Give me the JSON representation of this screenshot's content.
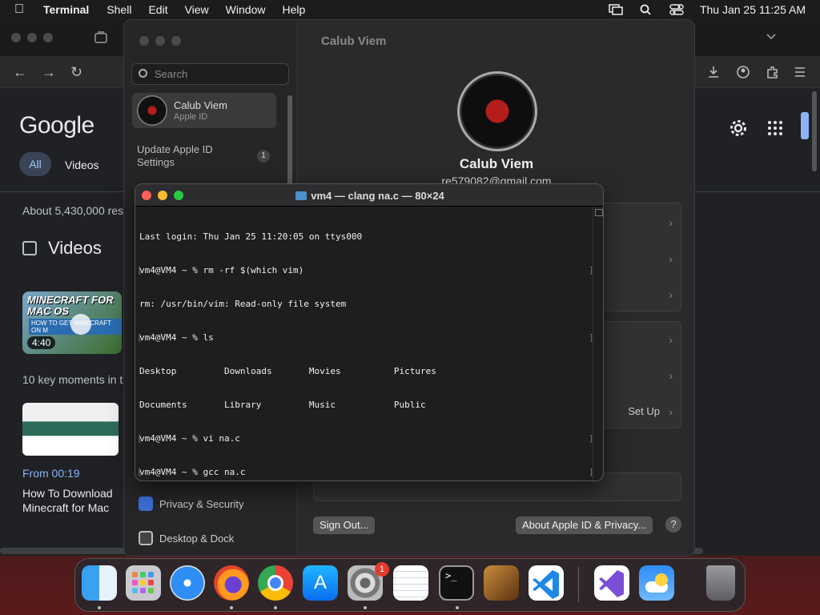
{
  "menubar": {
    "app": "Terminal",
    "items": [
      "Shell",
      "Edit",
      "View",
      "Window",
      "Help"
    ],
    "datetime": "Thu Jan 25  11:25 AM"
  },
  "browser": {
    "logo": "Google",
    "tabs": [
      "All",
      "Videos"
    ],
    "results": "About 5,430,000 res",
    "videos_heading": "Videos",
    "thumb_title": "MINECRAFT FOR MAC OS",
    "thumb_subtitle": "HOW TO GET MINECRAFT ON M",
    "duration": "4:40",
    "key_moments": "10 key moments in t",
    "from": "From 00:19",
    "video_title_1": "How To Download",
    "video_title_2": "Minecraft for Mac"
  },
  "settings": {
    "search_placeholder": "Search",
    "user_name": "Calub Viem",
    "user_sub": "Apple ID",
    "update_line1": "Update Apple ID",
    "update_line2": "Settings",
    "update_badge": "1",
    "privacy": "Privacy & Security",
    "desktop_dock": "Desktop & Dock",
    "pane_title": "Calub Viem",
    "profile_name": "Calub Viem",
    "email": "re579082@gmail.com",
    "setup": "Set Up",
    "sign_out": "Sign Out...",
    "about": "About Apple ID & Privacy...",
    "help": "?"
  },
  "terminal": {
    "title": "vm4 — clang na.c — 80×24",
    "lines": [
      "Last login: Thu Jan 25 11:20:05 on ttys000",
      "vm4@VM4 ~ % rm -rf $(which vim)",
      "rm: /usr/bin/vim: Read-only file system",
      "vm4@VM4 ~ % ls",
      "Desktop         Downloads       Movies          Pictures",
      "Documents       Library         Music           Public",
      "vm4@VM4 ~ % vi na.c",
      "vm4@VM4 ~ % gcc na.c"
    ]
  },
  "dock": {
    "apps": [
      "Finder",
      "Launchpad",
      "Safari",
      "Firefox",
      "Chrome",
      "App Store",
      "System Settings",
      "TextEdit",
      "Terminal",
      "GarageBand",
      "VS Code",
      "Visual Studio",
      "Weather",
      "Trash"
    ],
    "settings_badge": "1"
  }
}
